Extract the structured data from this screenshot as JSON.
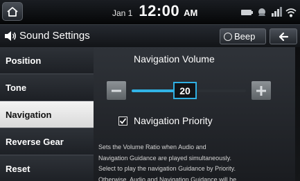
{
  "status_bar": {
    "date": "Jan 1",
    "time": "12:00",
    "ampm": "AM",
    "icons": [
      "battery-icon",
      "gps-icon",
      "signal-icon",
      "wifi-icon"
    ]
  },
  "header": {
    "icon": "speaker-sound-icon",
    "title": "Sound Settings",
    "beep_label": "Beep",
    "back_icon": "back-arrow-icon"
  },
  "sidebar": {
    "active_index": 2,
    "items": [
      {
        "label": "Position"
      },
      {
        "label": "Tone"
      },
      {
        "label": "Navigation"
      },
      {
        "label": "Reverse Gear"
      },
      {
        "label": "Reset"
      }
    ]
  },
  "main": {
    "title": "Navigation Volume",
    "volume": {
      "value": "20",
      "level": 0.45
    },
    "priority": {
      "label": "Navigation Priority",
      "checked": true
    },
    "description_lines": [
      "Sets the Volume Ratio when Audio and",
      "Navigation Guidance are played simultaneously.",
      "Select to play the navigation Guidance by Priority.",
      "Otherwise, Audio and Navigation Guidance will be"
    ]
  },
  "colors": {
    "accent": "#32b3e6",
    "active_item_bg": "#efefef"
  }
}
